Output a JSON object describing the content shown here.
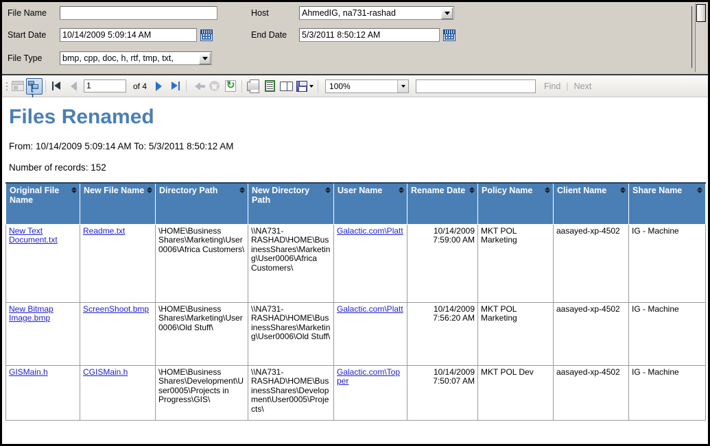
{
  "filters": {
    "file_name_label": "File Name",
    "file_name_value": "",
    "start_date_label": "Start Date",
    "start_date_value": "10/14/2009 5:09:14 AM",
    "file_type_label": "File Type",
    "file_type_value": "bmp, cpp, doc, h, rtf, tmp, txt,",
    "host_label": "Host",
    "host_value": "AhmedIG, na731-rashad",
    "end_date_label": "End Date",
    "end_date_value": "5/3/2011 8:50:12 AM"
  },
  "toolbar": {
    "current_page": "1",
    "of_text": "of  4",
    "zoom_value": "100%",
    "find_label": "Find",
    "separator": "|",
    "next_label": "Next",
    "find_value": ""
  },
  "report": {
    "title": "Files Renamed",
    "range_line": "From: 10/14/2009 5:09:14 AM  To: 5/3/2011 8:50:12 AM",
    "records_line": "Number of records: 152"
  },
  "table": {
    "columns": [
      "Original File Name",
      "New File Name",
      "Directory Path",
      "New Directory Path",
      "User Name",
      "Rename Date",
      "Policy Name",
      "Client Name",
      "Share Name"
    ],
    "rows": [
      {
        "original_file_name": "New Text Document.txt",
        "new_file_name": "Readme.txt",
        "directory_path": "\\HOME\\Business Shares\\Marketing\\User0006\\Africa Customers\\",
        "new_directory_path": "\\\\NA731-RASHAD\\HOME\\BusinessShares\\Marketing\\User0006\\Africa Customers\\",
        "user_name": "Galactic.com\\Platt",
        "rename_date": "10/14/2009 7:59:00 AM",
        "policy_name": "MKT POL Marketing",
        "client_name": "aasayed-xp-4502",
        "share_name": "IG - Machine"
      },
      {
        "original_file_name": "New Bitmap Image.bmp",
        "new_file_name": "ScreenShoot.bmp",
        "directory_path": "\\HOME\\Business Shares\\Marketing\\User0006\\Old Stuff\\",
        "new_directory_path": "\\\\NA731-RASHAD\\HOME\\BusinessShares\\Marketing\\User0006\\Old Stuff\\",
        "user_name": "Galactic.com\\Platt",
        "rename_date": "10/14/2009 7:56:20 AM",
        "policy_name": "MKT POL Marketing",
        "client_name": "aasayed-xp-4502",
        "share_name": "IG - Machine"
      },
      {
        "original_file_name": "GISMain.h",
        "new_file_name": "CGISMain.h",
        "directory_path": "\\HOME\\Business Shares\\Development\\User0005\\Projects in Progress\\GIS\\",
        "new_directory_path": "\\\\NA731-RASHAD\\HOME\\BusinessShares\\Development\\User0005\\Projects\\",
        "user_name": "Galactic.com\\Topper",
        "rename_date": "10/14/2009 7:50:07 AM",
        "policy_name": "MKT POL Dev",
        "client_name": "aasayed-xp-4502",
        "share_name": "IG - Machine"
      }
    ]
  },
  "colors": {
    "header_blue": "#4a7fb5",
    "title_blue": "#4a7fb5",
    "link_blue": "#1d1dd0",
    "panel_gray": "#d4d0c8"
  }
}
